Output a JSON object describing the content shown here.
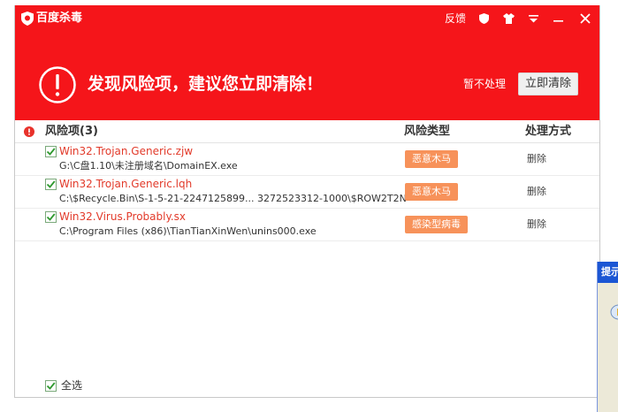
{
  "theme": {
    "red": "#f5151a",
    "badge": "#f7925a",
    "threat_text": "#e23a2a"
  },
  "titlebar": {
    "app_title": "百度杀毒",
    "feedback": "反馈",
    "icons": [
      "shield-icon",
      "shirt-icon",
      "menu-icon",
      "minimize-icon",
      "close-icon"
    ]
  },
  "alert": {
    "title": "发现风险项，建议您立即清除！",
    "ignore": "暂不处理",
    "clean": "立即清除"
  },
  "table": {
    "columns": {
      "name": "风险项(3)",
      "type": "风险类型",
      "action": "处理方式"
    },
    "rows": [
      {
        "name": "Win32.Trojan.Generic.zjw",
        "path": "G:\\C盘1.10\\未注册域名\\DomainEX.exe",
        "type": "恶意木马",
        "action": "删除"
      },
      {
        "name": "Win32.Trojan.Generic.lqh",
        "path": "C:\\$Recycle.Bin\\S-1-5-21-2247125899... 3272523312-1000\\$ROW2T2N",
        "type": "恶意木马",
        "action": "删除"
      },
      {
        "name": "Win32.Virus.Probably.sx",
        "path": "C:\\Program Files (x86)\\TianTianXinWen\\unins000.exe",
        "type": "感染型病毒",
        "action": "删除"
      }
    ]
  },
  "footer": {
    "select_all": "全选"
  },
  "side_dialog": {
    "title": "提示"
  }
}
